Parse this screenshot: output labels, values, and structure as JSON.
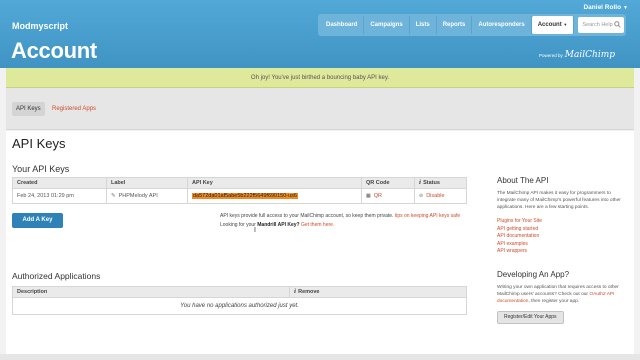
{
  "header": {
    "brand": "Modmyscript",
    "title": "Account",
    "user": "Daniel Rollo",
    "nav": [
      "Dashboard",
      "Campaigns",
      "Lists",
      "Reports",
      "Autoresponders",
      "Account"
    ],
    "search_placeholder": "Search Help",
    "powered_by": "Powered by",
    "powered_logo": "MailChimp"
  },
  "banner": {
    "message": "Oh joy! You've just birthed a bouncing baby API key."
  },
  "subnav": {
    "tabs": [
      "API Keys",
      "Registered Apps"
    ]
  },
  "main": {
    "title": "API Keys",
    "your_keys_heading": "Your API Keys",
    "keys_table": {
      "headers": [
        "Created",
        "Label",
        "API Key",
        "QR Code",
        "Status"
      ],
      "rows": [
        {
          "created": "Feb 24, 2013 01:29 pm",
          "label": "PHPMelody API",
          "api_key": "da572da01af5abe5b222f5649f690150-us6",
          "qr": "QR",
          "status": "Disable"
        }
      ]
    },
    "add_button": "Add A Key",
    "help_line1_text": "API keys provide full access to your MailChimp account, so keep them private.",
    "help_line1_link": "tips on keeping API keys safe",
    "help_line2_text": "Looking for your",
    "help_line2_bold": "Mandrill API Key?",
    "help_line2_link": "Get them here.",
    "authorized_heading": "Authorized Applications",
    "apps_table": {
      "headers": [
        "Description",
        "Remove"
      ],
      "empty": "You have no applications authorized just yet."
    }
  },
  "sidebar": {
    "about_heading": "About The API",
    "about_text": "The MailChimp API makes it easy for programmers to integrate many of MailChimp's powerful features into other applications. Here are a few starting points.",
    "links": [
      "Plugins for Your Site",
      "API getting started",
      "API documentation",
      "API examples",
      "API wrappers"
    ],
    "dev_heading": "Developing An App?",
    "dev_text_before": "Writing your own application that requires access to other MailChimp users' accounts? Check out our",
    "dev_link": "OAuth2 API documentation",
    "dev_text_after": ", then register your app.",
    "register_button": "Register/Edit Your Apps"
  },
  "colors": {
    "header_blue": "#4a9fce",
    "banner_green": "#dfe99b",
    "link_red": "#d04b2b",
    "key_highlight": "#f08a24",
    "button_blue": "#2e82b8"
  }
}
